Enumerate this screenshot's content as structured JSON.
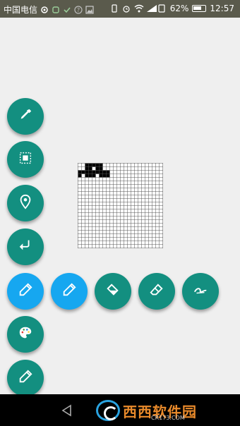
{
  "status_bar": {
    "carrier": "中国电信",
    "battery_percent": "62%",
    "time": "12:57",
    "battery_level": 0.62
  },
  "tools": {
    "vertical": [
      {
        "name": "eyedropper-icon",
        "active": false
      },
      {
        "name": "select-rect-icon",
        "active": false
      },
      {
        "name": "location-pin-icon",
        "active": false
      },
      {
        "name": "undo-arrow-icon",
        "active": false
      },
      {
        "name": "pencil-icon",
        "active": true
      },
      {
        "name": "palette-icon",
        "active": false
      },
      {
        "name": "pencil-icon",
        "active": false
      }
    ],
    "horizontal": [
      {
        "name": "pencil-icon",
        "active": true
      },
      {
        "name": "bucket-fill-icon",
        "active": false
      },
      {
        "name": "eraser-icon",
        "active": false
      },
      {
        "name": "squiggle-icon",
        "active": false
      }
    ]
  },
  "canvas": {
    "columns": 24,
    "rows": 24,
    "filled_pixels": [
      [
        2,
        0
      ],
      [
        3,
        0
      ],
      [
        4,
        0
      ],
      [
        5,
        0
      ],
      [
        6,
        0
      ],
      [
        2,
        1
      ],
      [
        3,
        1
      ],
      [
        5,
        1
      ],
      [
        6,
        1
      ],
      [
        0,
        2
      ],
      [
        1,
        2
      ],
      [
        2,
        2
      ],
      [
        3,
        2
      ],
      [
        4,
        2
      ],
      [
        5,
        2
      ],
      [
        6,
        2
      ],
      [
        7,
        2
      ],
      [
        8,
        2
      ],
      [
        0,
        3
      ],
      [
        2,
        3
      ],
      [
        3,
        3
      ],
      [
        4,
        3
      ],
      [
        6,
        3
      ],
      [
        7,
        3
      ],
      [
        8,
        3
      ]
    ]
  },
  "watermark": {
    "text": "西西软件园",
    "sub": "CR173.COM"
  },
  "colors": {
    "fab": "#138f80",
    "fab_active": "#16a7f0",
    "background": "#efefef"
  }
}
